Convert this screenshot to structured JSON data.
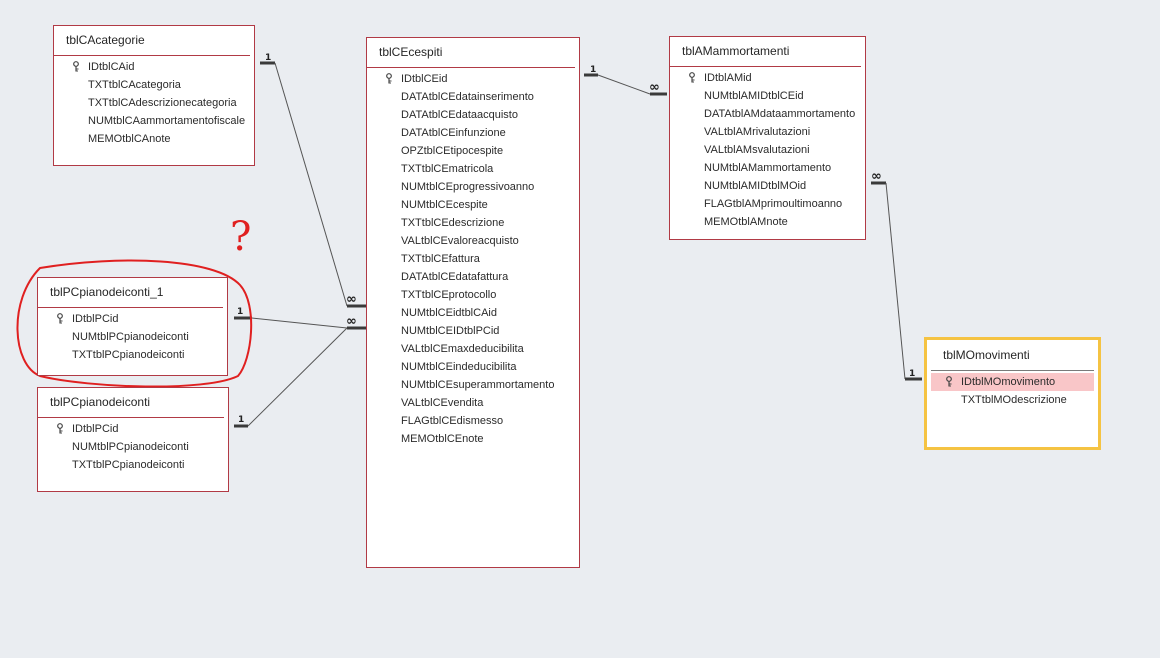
{
  "tables": {
    "categorie": {
      "title": "tblCAcategorie",
      "fields": [
        "IDtblCAid",
        "TXTtblCAcategoria",
        "TXTtblCAdescrizionecategoria",
        "NUMtblCAammortamentofiscale",
        "MEMOtblCAnote"
      ]
    },
    "cespiti": {
      "title": "tblCEcespiti",
      "fields": [
        "IDtblCEid",
        "DATAtblCEdatainserimento",
        "DATAtblCEdataacquisto",
        "DATAtblCEinfunzione",
        "OPZtblCEtipocespite",
        "TXTtblCEmatricola",
        "NUMtblCEprogressivoanno",
        "NUMtblCEcespite",
        "TXTtblCEdescrizione",
        "VALtblCEvaloreacquisto",
        "TXTtblCEfattura",
        "DATAtblCEdatafattura",
        "TXTtblCEprotocollo",
        "NUMtblCEidtblCAid",
        "NUMtblCEIDtblPCid",
        "VALtblCEmaxdeducibilita",
        "NUMtblCEindeducibilita",
        "NUMtblCEsuperammortamento",
        "VALtblCEvendita",
        "FLAGtblCEdismesso",
        "MEMOtblCEnote"
      ]
    },
    "ammortamenti": {
      "title": "tblAMammortamenti",
      "fields": [
        "IDtblAMid",
        "NUMtblAMIDtblCEid",
        "DATAtblAMdataammortamento",
        "VALtblAMrivalutazioni",
        "VALtblAMsvalutazioni",
        "NUMtblAMammortamento",
        "NUMtblAMIDtblMOid",
        "FLAGtblAMprimoultimoanno",
        "MEMOtblAMnote"
      ]
    },
    "pianoconti1": {
      "title": "tblPCpianodeiconti_1",
      "fields": [
        "IDtblPCid",
        "NUMtblPCpianodeiconti",
        "TXTtblPCpianodeiconti"
      ]
    },
    "pianoconti": {
      "title": "tblPCpianodeiconti",
      "fields": [
        "IDtblPCid",
        "NUMtblPCpianodeiconti",
        "TXTtblPCpianodeiconti"
      ]
    },
    "movimenti": {
      "title": "tblMOmovimenti",
      "fields": [
        "IDtblMOmovimento",
        "TXTtblMOdescrizione"
      ]
    }
  },
  "relationships": {
    "one_label": "1",
    "many_label": "∞"
  },
  "annotation": {
    "mark": "?",
    "color": "#e02020"
  },
  "colors": {
    "table_border": "#b13a45",
    "selected_border": "#f5c342",
    "highlight_row": "#f9c6c8",
    "background": "#eaedf1",
    "line": "#3a3a3a"
  }
}
